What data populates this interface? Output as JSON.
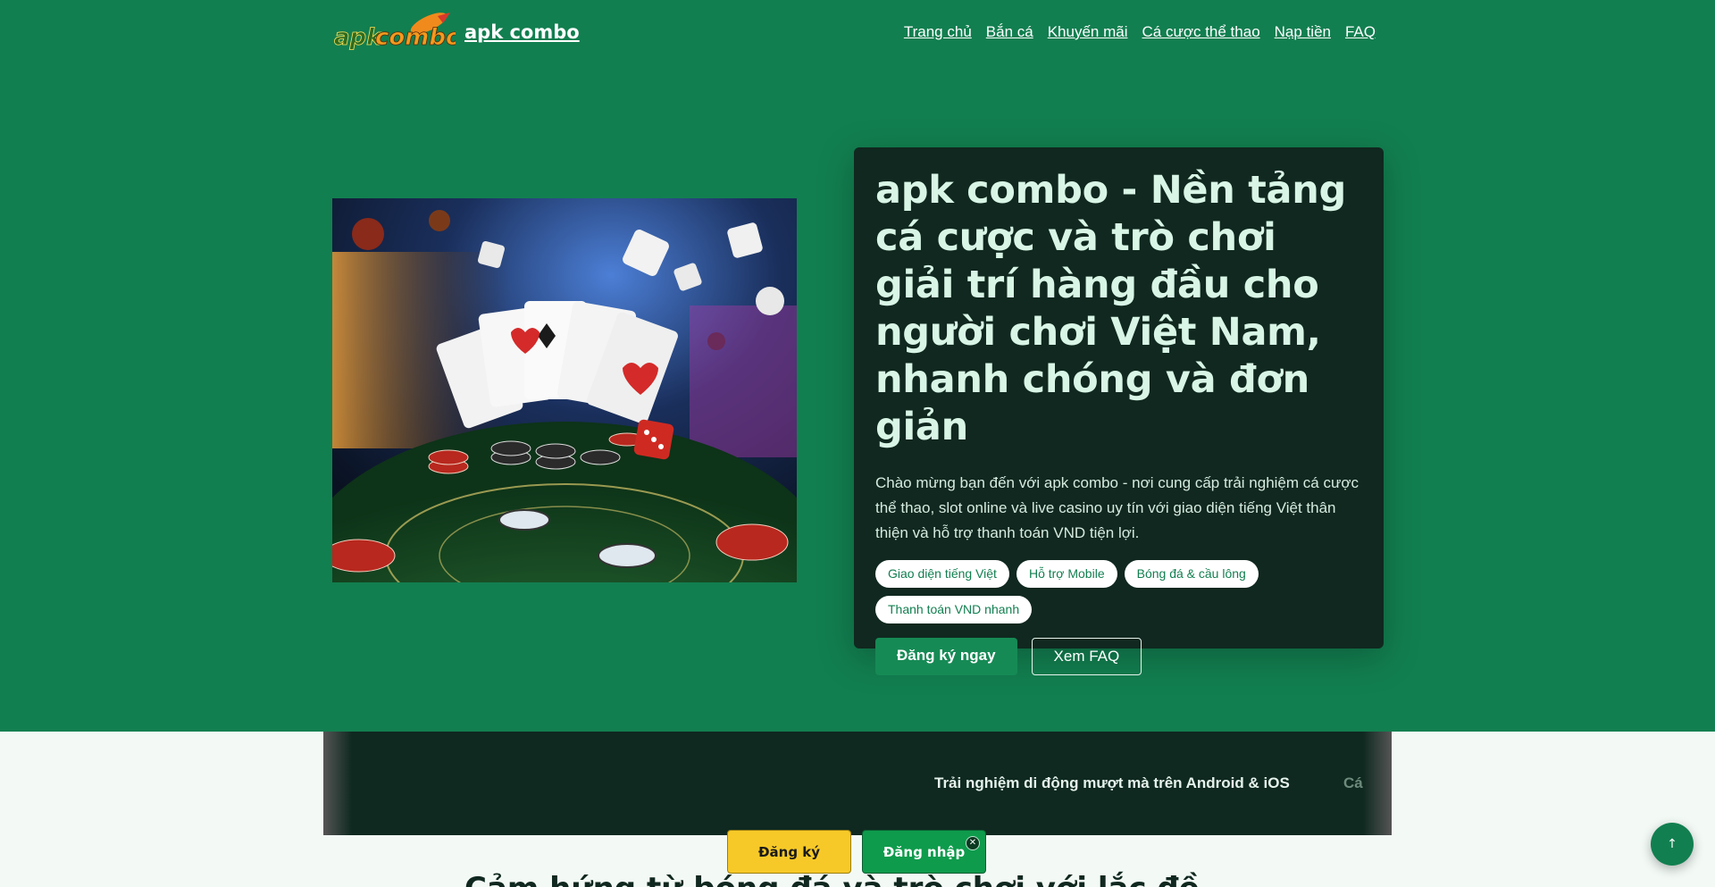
{
  "header": {
    "logo_text": "apkcombo",
    "brand_name": "apk combo",
    "nav": [
      {
        "label": "Trang chủ"
      },
      {
        "label": "Bắn cá"
      },
      {
        "label": "Khuyến mãi"
      },
      {
        "label": "Cá cược thể thao"
      },
      {
        "label": "Nạp tiền"
      },
      {
        "label": "FAQ"
      }
    ]
  },
  "hero": {
    "image_alt": "casino-cards-chips-dice",
    "title": "apk combo - Nền tảng cá cược và trò chơi giải trí hàng đầu cho người chơi Việt Nam, nhanh chóng và đơn giản",
    "description": "Chào mừng bạn đến với apk combo - nơi cung cấp trải nghiệm cá cược thể thao, slot online và live casino uy tín với giao diện tiếng Việt thân thiện và hỗ trợ thanh toán VND tiện lợi.",
    "tags": [
      {
        "label": "Giao diện tiếng Việt"
      },
      {
        "label": "Hỗ trợ Mobile"
      },
      {
        "label": "Bóng đá & cầu lông"
      },
      {
        "label": "Thanh toán VND nhanh"
      }
    ],
    "primary_button": "Đăng ký ngay",
    "secondary_button": "Xem FAQ"
  },
  "ticker": {
    "items": [
      {
        "label": "Trải nghiệm di động mượt mà trên Android & iOS"
      },
      {
        "label": "Cá"
      }
    ]
  },
  "section": {
    "title_partial": "Cảm hứng từ bóng đá và trò chơi với lắc đề"
  },
  "floatbar": {
    "register_label": "Đăng ký",
    "login_label": "Đăng nhập",
    "close_glyph": "✕"
  },
  "back_to_top_glyph": "↑",
  "colors": {
    "background": "#127f50",
    "card": "#10281f",
    "register": "#f7c928",
    "login": "#0e9b4c"
  }
}
